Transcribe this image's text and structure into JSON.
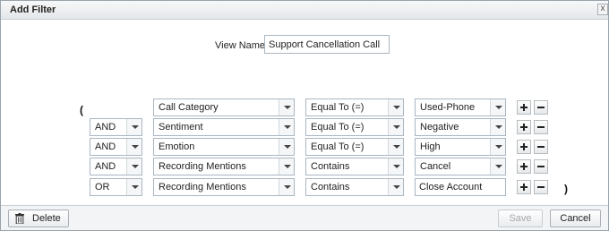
{
  "dialog": {
    "title": "Add Filter",
    "close_glyph": "x"
  },
  "view_name": {
    "label": "View Name:",
    "value": "Support Cancellation Call"
  },
  "parens": {
    "open": "(",
    "close": ")"
  },
  "rows": [
    {
      "operator": "",
      "field": "Call Category",
      "comparison": "Equal To (=)",
      "value": "Used-Phone",
      "value_type": "select"
    },
    {
      "operator": "AND",
      "field": "Sentiment",
      "comparison": "Equal To (=)",
      "value": "Negative",
      "value_type": "select"
    },
    {
      "operator": "AND",
      "field": "Emotion",
      "comparison": "Equal To (=)",
      "value": "High",
      "value_type": "select"
    },
    {
      "operator": "AND",
      "field": "Recording Mentions",
      "comparison": "Contains",
      "value": "Cancel",
      "value_type": "select"
    },
    {
      "operator": "OR",
      "field": "Recording Mentions",
      "comparison": "Contains",
      "value": "Close Account",
      "value_type": "text"
    }
  ],
  "footer": {
    "delete_label": "Delete",
    "save_label": "Save",
    "cancel_label": "Cancel",
    "save_enabled": false
  },
  "icons": {
    "add": "plus-icon",
    "remove": "minus-icon",
    "delete": "trash-icon",
    "dropdown": "chevron-down-icon"
  }
}
